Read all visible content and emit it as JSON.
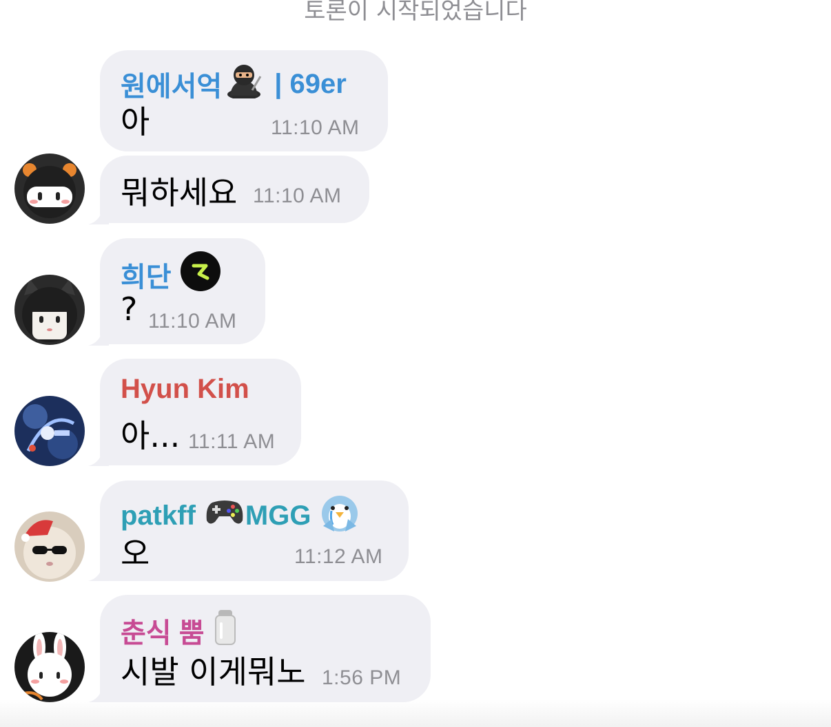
{
  "system_message": "토론이 시작되었습니다",
  "messages": [
    {
      "sender": "원에서억",
      "sender_suffix": "| 69er",
      "sender_color": "#3a8fd6",
      "text": "아",
      "time": "11:10 AM",
      "sender_emoji": "ninja-emoji"
    },
    {
      "text": "뭐하세요",
      "time": "11:10 AM",
      "avatar": "ninja-bear-avatar"
    },
    {
      "sender": "희단",
      "sender_color": "#3a8fd6",
      "text": "?",
      "time": "11:10 AM",
      "sender_emoji": "r-badge-icon",
      "avatar": "cat-girl-avatar"
    },
    {
      "sender": "Hyun Kim",
      "sender_color": "#d2504a",
      "text": "아...",
      "time": "11:11 AM",
      "avatar": "blue-art-avatar"
    },
    {
      "sender": "patkff",
      "sender_suffix": "MGG",
      "sender_color": "#2e9fb5",
      "text": "오",
      "time": "11:12 AM",
      "sender_emoji": "gamepad-emoji",
      "sender_emoji_2": "crying-penguin-emoji",
      "avatar": "cool-cat-avatar"
    },
    {
      "sender": "춘식 뿜",
      "sender_color": "#c74b94",
      "text": "시발 이게뭐노",
      "time": "1:56 PM",
      "sender_emoji": "salt-shaker-emoji",
      "avatar": "bunny-avatar"
    }
  ]
}
